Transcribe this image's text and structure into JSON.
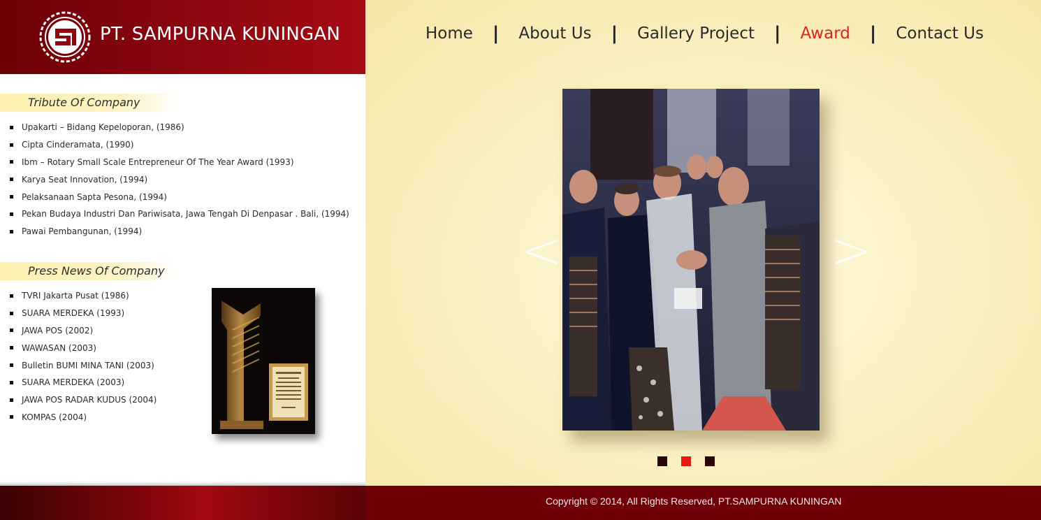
{
  "header": {
    "company_name": "PT. SAMPURNA KUNINGAN",
    "logo_icon": "sp-logo-icon"
  },
  "nav": {
    "items": [
      {
        "label": "Home",
        "active": false
      },
      {
        "label": "About Us",
        "active": false
      },
      {
        "label": "Gallery Project",
        "active": false
      },
      {
        "label": "Award",
        "active": true
      },
      {
        "label": "Contact Us",
        "active": false
      }
    ],
    "separator": "|",
    "active_color": "#d9251b"
  },
  "tribute": {
    "title": "Tribute Of Company",
    "items": [
      "Upakarti – Bidang Kepeloporan, (1986)",
      "Cipta Cinderamata, (1990)",
      "Ibm – Rotary Small Scale Entrepreneur Of The Year Award (1993)",
      "Karya Seat Innovation, (1994)",
      "Pelaksanaan Sapta Pesona, (1994)",
      "Pekan Budaya Industri Dan Pariwisata, Jawa Tengah Di Denpasar . Bali, (1994)",
      "Pawai Pembangunan, (1994)"
    ]
  },
  "press": {
    "title": "Press News Of Company",
    "items": [
      "TVRI Jakarta Pusat (1986)",
      "SUARA MERDEKA (1993)",
      "JAWA POS (2002)",
      "WAWASAN (2003)",
      "Bulletin BUMI MINA TANI (2003)",
      "SUARA MERDEKA (2003)",
      "JAWA POS RADAR KUDUS (2004)",
      "KOMPAS (2004)"
    ]
  },
  "slider": {
    "prev": "<",
    "next": ">",
    "dots": 3,
    "active_dot": 2
  },
  "footer": {
    "copyright": "Copyright © 2014, All Rights Reserved, PT.SAMPURNA KUNINGAN"
  }
}
